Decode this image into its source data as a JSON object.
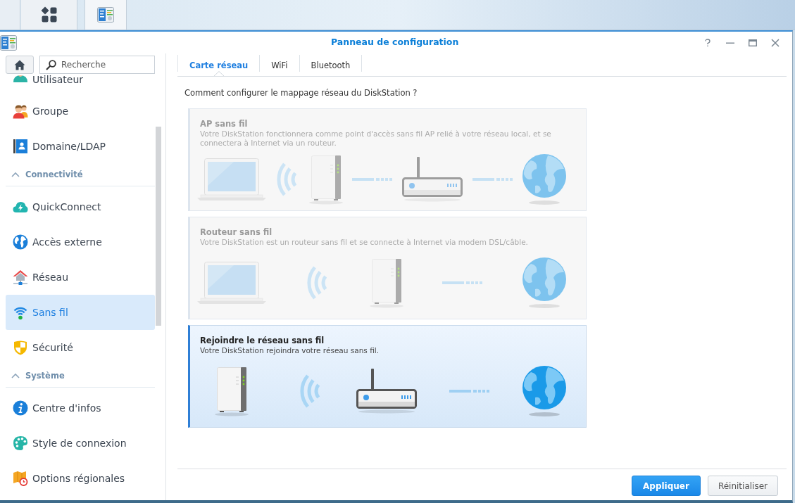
{
  "window": {
    "title": "Panneau de configuration"
  },
  "sidebar": {
    "search": {
      "placeholder": "Recherche"
    },
    "items": [
      {
        "kind": "item",
        "label": "Utilisateur",
        "selected": false
      },
      {
        "kind": "item",
        "label": "Groupe",
        "selected": false
      },
      {
        "kind": "item",
        "label": "Domaine/LDAP",
        "selected": false
      },
      {
        "kind": "section",
        "label": "Connectivité",
        "expanded": true
      },
      {
        "kind": "item",
        "label": "QuickConnect",
        "selected": false
      },
      {
        "kind": "item",
        "label": "Accès externe",
        "selected": false
      },
      {
        "kind": "item",
        "label": "Réseau",
        "selected": false
      },
      {
        "kind": "item",
        "label": "Sans fil",
        "selected": true
      },
      {
        "kind": "item",
        "label": "Sécurité",
        "selected": false
      },
      {
        "kind": "section",
        "label": "Système",
        "expanded": true
      },
      {
        "kind": "item",
        "label": "Centre d'infos",
        "selected": false
      },
      {
        "kind": "item",
        "label": "Style de connexion",
        "selected": false
      },
      {
        "kind": "item",
        "label": "Options régionales",
        "selected": false
      }
    ]
  },
  "tabs": [
    {
      "label": "Carte réseau",
      "selected": true
    },
    {
      "label": "WiFi",
      "selected": false
    },
    {
      "label": "Bluetooth",
      "selected": false
    }
  ],
  "question": "Comment configurer le mappage réseau du DiskStation ?",
  "options": [
    {
      "title": "AP sans fil",
      "description": "Votre DiskStation fonctionnera comme point d'accès sans fil AP relié à votre réseau local, et se connectera à Internet via un routeur.",
      "selected": false,
      "diagram": [
        {
          "kind": "laptop"
        },
        {
          "kind": "waves"
        },
        {
          "kind": "nas"
        },
        {
          "kind": "link"
        },
        {
          "kind": "router"
        },
        {
          "kind": "link"
        },
        {
          "kind": "globe"
        }
      ]
    },
    {
      "title": "Routeur sans fil",
      "description": "Votre DiskStation est un routeur sans fil et se connecte à Internet via modem DSL/câble.",
      "selected": false,
      "diagram": [
        {
          "kind": "laptop"
        },
        {
          "kind": "waves"
        },
        {
          "kind": "nas"
        },
        {
          "kind": "link"
        },
        {
          "kind": "globe"
        }
      ]
    },
    {
      "title": "Rejoindre le réseau sans fil",
      "description": "Votre DiskStation rejoindra votre réseau sans fil.",
      "selected": true,
      "diagram": [
        {
          "kind": "nas"
        },
        {
          "kind": "waves"
        },
        {
          "kind": "router"
        },
        {
          "kind": "link"
        },
        {
          "kind": "globe"
        }
      ]
    }
  ],
  "buttons": [
    {
      "label": "Appliquer",
      "kind": "primary"
    },
    {
      "label": "Réinitialiser",
      "kind": "secondary"
    }
  ]
}
